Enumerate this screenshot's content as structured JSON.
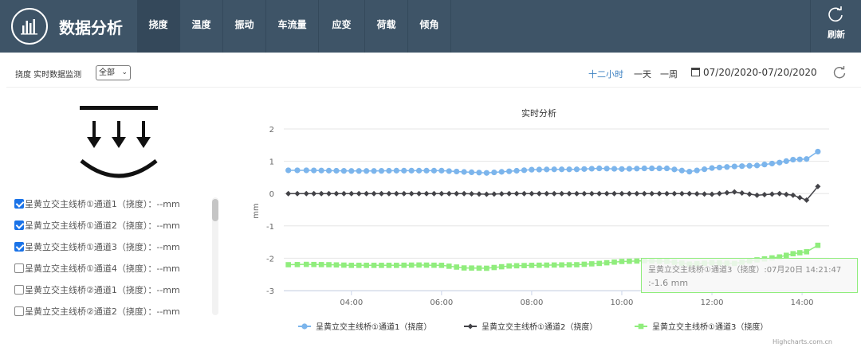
{
  "header": {
    "title": "数据分析",
    "tabs": [
      {
        "label": "挠度",
        "active": true
      },
      {
        "label": "温度"
      },
      {
        "label": "振动"
      },
      {
        "label": "车流量"
      },
      {
        "label": "应变"
      },
      {
        "label": "荷载"
      },
      {
        "label": "倾角"
      }
    ],
    "refresh_label": "刷新"
  },
  "toolbar": {
    "monitor_label": "挠度 实时数据监测",
    "scope_value": "全部",
    "ranges": [
      "十二小时",
      "一天",
      "一周"
    ],
    "active_range": "十二小时",
    "date_range": "07/20/2020-07/20/2020"
  },
  "channels": [
    {
      "label": "呈黄立交主线桥①通道1（挠度）：--mm",
      "checked": true
    },
    {
      "label": "呈黄立交主线桥①通道2（挠度）：--mm",
      "checked": true
    },
    {
      "label": "呈黄立交主线桥①通道3（挠度）：--mm",
      "checked": true
    },
    {
      "label": "呈黄立交主线桥①通道4（挠度）：--mm",
      "checked": false
    },
    {
      "label": "呈黄立交主线桥②通道1（挠度）：--mm",
      "checked": false
    },
    {
      "label": "呈黄立交主线桥②通道2（挠度）：--mm",
      "checked": false
    }
  ],
  "chart_data": {
    "type": "line",
    "title": "实时分析",
    "ylabel": "mm",
    "ylim": [
      -3,
      2
    ],
    "yticks": [
      2,
      1,
      0,
      -1,
      -2,
      -3
    ],
    "xlim": [
      2.5,
      14.6
    ],
    "xticks": [
      {
        "v": 4,
        "label": "04:00"
      },
      {
        "v": 6,
        "label": "06:00"
      },
      {
        "v": 8,
        "label": "08:00"
      },
      {
        "v": 10,
        "label": "10:00"
      },
      {
        "v": 12,
        "label": "12:00"
      },
      {
        "v": 14,
        "label": "14:00"
      }
    ],
    "x": [
      2.6,
      3.0,
      3.5,
      4.0,
      4.5,
      5.0,
      5.5,
      6.0,
      6.5,
      7.0,
      7.5,
      8.0,
      8.5,
      9.0,
      9.5,
      10.0,
      10.5,
      11.0,
      11.5,
      12.0,
      12.5,
      13.0,
      13.5,
      13.8,
      14.1,
      14.35
    ],
    "series": [
      {
        "name": "呈黄立交主线桥①通道1（挠度）",
        "color": "#7cb5ec",
        "marker": "circle",
        "values": [
          0.72,
          0.72,
          0.71,
          0.7,
          0.7,
          0.71,
          0.71,
          0.71,
          0.67,
          0.64,
          0.69,
          0.74,
          0.75,
          0.75,
          0.78,
          0.76,
          0.78,
          0.78,
          0.68,
          0.79,
          0.84,
          0.87,
          0.96,
          1.05,
          1.07,
          1.3
        ]
      },
      {
        "name": "呈黄立交主线桥①通道2（挠度）",
        "color": "#434348",
        "marker": "diamond",
        "values": [
          0.0,
          0.0,
          0.0,
          0.0,
          0.0,
          0.0,
          0.0,
          0.0,
          0.0,
          -0.02,
          0.0,
          0.0,
          0.0,
          0.0,
          0.0,
          0.0,
          0.0,
          0.0,
          0.0,
          -0.02,
          0.05,
          -0.05,
          0.0,
          -0.05,
          -0.2,
          0.22
        ]
      },
      {
        "name": "呈黄立交主线桥①通道3（挠度）",
        "color": "#90ed7d",
        "marker": "square",
        "values": [
          -2.2,
          -2.19,
          -2.2,
          -2.22,
          -2.22,
          -2.22,
          -2.21,
          -2.22,
          -2.3,
          -2.31,
          -2.24,
          -2.22,
          -2.21,
          -2.2,
          -2.16,
          -2.1,
          -2.08,
          -2.1,
          -2.18,
          -2.14,
          -2.16,
          -2.05,
          -1.96,
          -1.86,
          -1.8,
          -1.6
        ]
      }
    ],
    "tooltip": {
      "line1": "呈黄立交主线桥①通道3（挠度）:07月20日 14:21:47",
      "line2": ":-1.6 mm"
    },
    "credits": "Highcharts.com.cn"
  }
}
